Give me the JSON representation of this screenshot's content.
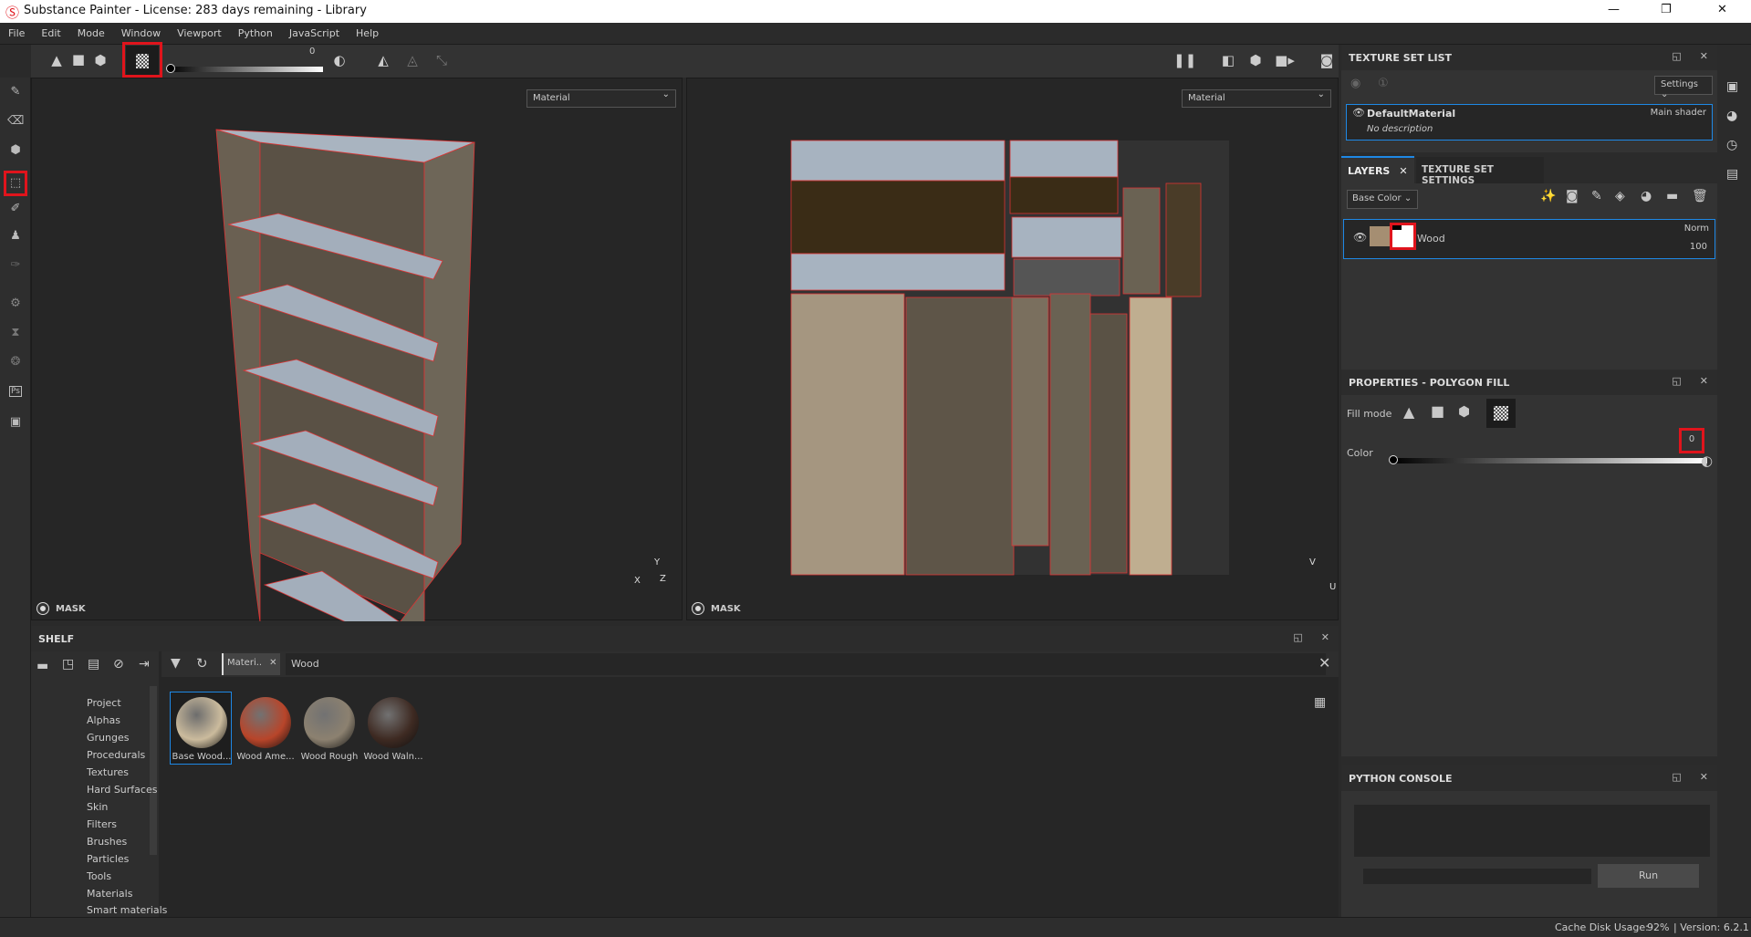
{
  "window": {
    "title": "Substance Painter - License: 283 days remaining - Library",
    "controls": [
      "—",
      "❐",
      "✕"
    ]
  },
  "menu": [
    "File",
    "Edit",
    "Mode",
    "Window",
    "Viewport",
    "Python",
    "JavaScript",
    "Help"
  ],
  "toolbar": {
    "fill_modes": [
      "triangle-icon",
      "square-icon",
      "cube-icon",
      "checker-icon"
    ],
    "selected_fill_mode": "checker-icon",
    "color_value": "0"
  },
  "viewports": {
    "left": {
      "channel": "Material",
      "mask_label": "MASK",
      "axes": [
        "Y",
        "X",
        "Z"
      ]
    },
    "right": {
      "channel": "Material",
      "mask_label": "MASK",
      "axes": [
        "V",
        "U"
      ]
    }
  },
  "texture_set_list": {
    "title": "TEXTURE SET LIST",
    "settings_label": "Settings",
    "material": {
      "name": "DefaultMaterial",
      "shader": "Main shader",
      "description": "No description"
    }
  },
  "layers": {
    "tab_layers": "LAYERS",
    "tab_settings": "TEXTURE SET SETTINGS",
    "channel": "Base Color",
    "layer": {
      "name": "Wood",
      "blend": "Norm",
      "opacity": "100"
    }
  },
  "properties": {
    "title": "PROPERTIES - POLYGON FILL",
    "fill_mode_label": "Fill mode",
    "color_label": "Color",
    "color_value": "0"
  },
  "python_console": {
    "title": "PYTHON CONSOLE",
    "run_label": "Run"
  },
  "shelf": {
    "title": "SHELF",
    "filter_tag": "Materi..",
    "search": "Wood",
    "categories": [
      "Project",
      "Alphas",
      "Grunges",
      "Procedurals",
      "Textures",
      "Hard Surfaces",
      "Skin",
      "Filters",
      "Brushes",
      "Particles",
      "Tools",
      "Materials",
      "Smart materials"
    ],
    "items": [
      {
        "label": "Base Wood...",
        "color": "#cbbb9d"
      },
      {
        "label": "Wood Ame...",
        "color": "#b8452a"
      },
      {
        "label": "Wood Rough",
        "color": "#8c8170"
      },
      {
        "label": "Wood Waln...",
        "color": "#3e2a22"
      }
    ]
  },
  "status": {
    "cache_label": "Cache Disk Usage:",
    "cache_value": "92%",
    "version": "| Version: 6.2.1"
  },
  "colors": {
    "accent": "#1e88e5",
    "highlight": "#e0141c"
  }
}
